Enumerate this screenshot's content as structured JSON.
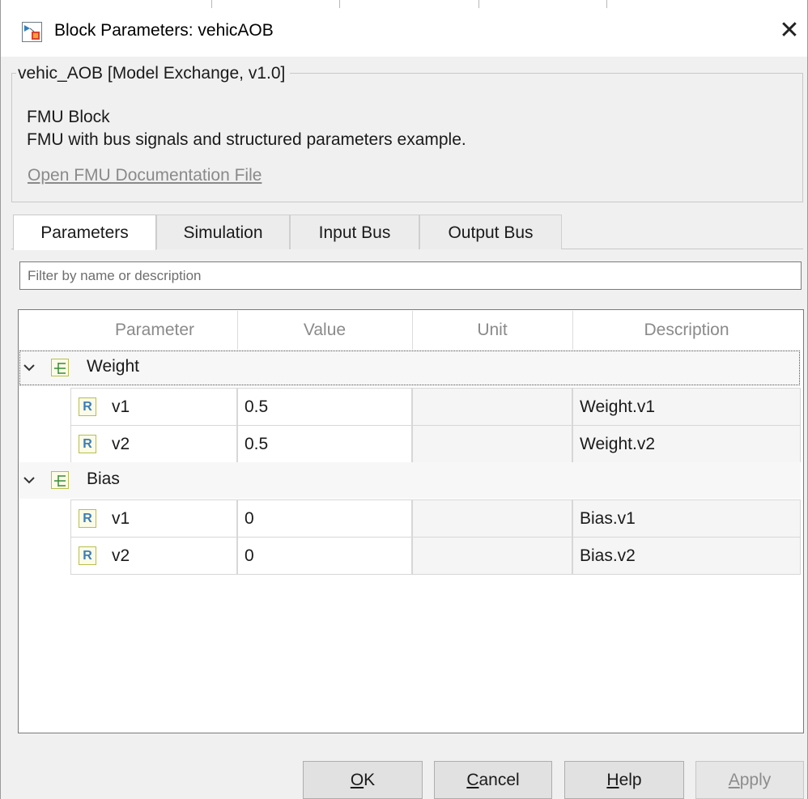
{
  "window": {
    "title": "Block Parameters: vehicAOB",
    "close_glyph": "✕"
  },
  "group": {
    "legend": "vehic_AOB [Model Exchange, v1.0]",
    "block_type": "FMU Block",
    "description": "FMU with bus signals and structured parameters example.",
    "doc_link": "Open FMU Documentation File"
  },
  "tabs": [
    {
      "label": "Parameters",
      "active": true
    },
    {
      "label": "Simulation",
      "active": false
    },
    {
      "label": "Input Bus",
      "active": false
    },
    {
      "label": "Output Bus",
      "active": false
    }
  ],
  "filter": {
    "placeholder": "Filter by name or description"
  },
  "table": {
    "headers": {
      "parameter": "Parameter",
      "value": "Value",
      "unit": "Unit",
      "description": "Description"
    },
    "groups": [
      {
        "name": "Weight",
        "icon": "struct-icon",
        "rows": [
          {
            "icon_letter": "R",
            "name": "v1",
            "value": "0.5",
            "unit": "",
            "description": "Weight.v1"
          },
          {
            "icon_letter": "R",
            "name": "v2",
            "value": "0.5",
            "unit": "",
            "description": "Weight.v2"
          }
        ]
      },
      {
        "name": "Bias",
        "icon": "struct-icon",
        "rows": [
          {
            "icon_letter": "R",
            "name": "v1",
            "value": "0",
            "unit": "",
            "description": "Bias.v1"
          },
          {
            "icon_letter": "R",
            "name": "v2",
            "value": "0",
            "unit": "",
            "description": "Bias.v2"
          }
        ]
      }
    ]
  },
  "buttons": {
    "ok": {
      "prefix": "",
      "mnemonic": "O",
      "rest": "K",
      "enabled": true
    },
    "cancel": {
      "prefix": "",
      "mnemonic": "C",
      "rest": "ancel",
      "enabled": true
    },
    "help": {
      "prefix": "",
      "mnemonic": "H",
      "rest": "elp",
      "enabled": true
    },
    "apply": {
      "prefix": "",
      "mnemonic": "A",
      "rest": "pply",
      "enabled": false
    }
  },
  "colors": {
    "background": "#f0f0f0",
    "link": "#8a8a8a",
    "icon_border": "#b7bf4c",
    "icon_letter": "#3c7db8"
  }
}
